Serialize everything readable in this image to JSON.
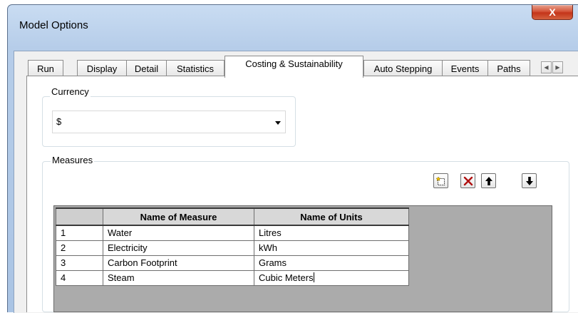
{
  "window": {
    "title": "Model Options",
    "close_label": "X"
  },
  "tabs": [
    {
      "label": "Run"
    },
    {
      "label": "Display"
    },
    {
      "label": "Detail"
    },
    {
      "label": "Statistics"
    },
    {
      "label": "Costing & Sustainability",
      "active": true
    },
    {
      "label": "Auto Stepping"
    },
    {
      "label": "Events"
    },
    {
      "label": "Paths"
    }
  ],
  "currency": {
    "label": "Currency",
    "value": "$"
  },
  "measures": {
    "label": "Measures",
    "toolbar": [
      "new-icon",
      "delete-icon",
      "move-up-icon",
      "move-down-icon"
    ],
    "columns": [
      "Name of Measure",
      "Name of Units"
    ],
    "rows": [
      {
        "num": "1",
        "measure": "Water",
        "units": "Litres"
      },
      {
        "num": "2",
        "measure": "Electricity",
        "units": "kWh"
      },
      {
        "num": "3",
        "measure": "Carbon Footprint",
        "units": "Grams"
      },
      {
        "num": "4",
        "measure": "Steam",
        "units": "Cubic Meters"
      }
    ]
  },
  "colors": {
    "close_button": "#c4341a",
    "delete_icon": "#b01010"
  }
}
